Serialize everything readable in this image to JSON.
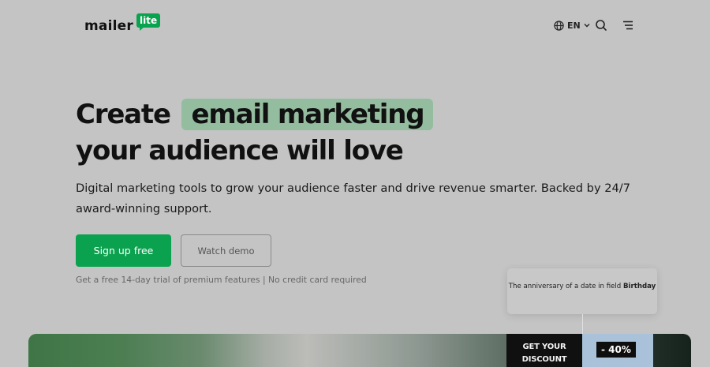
{
  "brand": {
    "name": "mailer",
    "badge": "lite",
    "color": "#09a24e"
  },
  "header": {
    "language": "EN"
  },
  "hero": {
    "title_part1": "Create",
    "title_highlight": "email marketing",
    "title_line2": "your audience will love",
    "subtitle": "Digital marketing tools to grow your audience faster and drive revenue smarter. Backed by 24/7 award-winning support.",
    "primary_cta": "Sign up free",
    "secondary_cta": "Watch demo",
    "fineprint": "Get a free 14-day trial of premium features | No credit card required"
  },
  "event_card": {
    "text": "The anniversary of a date in field",
    "field": "Birthday"
  },
  "promo": {
    "line1": "GET YOUR",
    "line2": "DISCOUNT",
    "discount": "- 40%"
  },
  "icons": [
    "globe-icon",
    "chevron-down-icon",
    "search-icon",
    "menu-icon"
  ],
  "colors": {
    "accent": "#0ba24f",
    "highlight": "#94bd9f",
    "background": "#c4c4c4"
  }
}
